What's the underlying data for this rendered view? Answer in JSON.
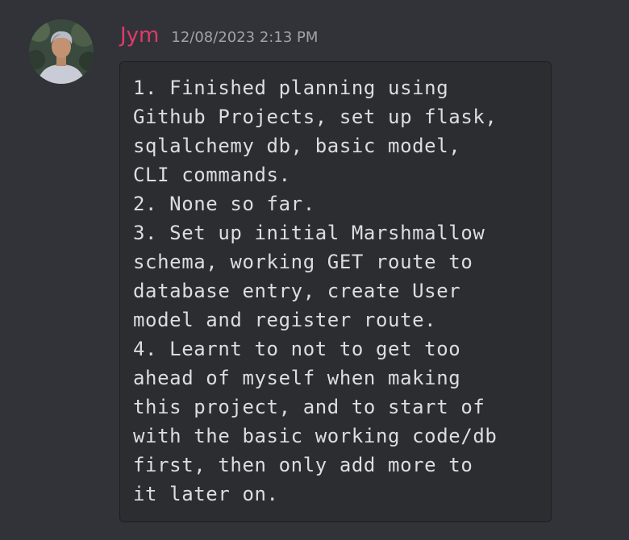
{
  "message": {
    "author": "Jym",
    "timestamp": "12/08/2023 2:13 PM",
    "avatar_icon": "user-avatar",
    "author_color": "#e23a6a",
    "code_lines": [
      "1. Finished planning using",
      "Github Projects, set up flask,",
      "sqlalchemy db, basic model,",
      "CLI commands.",
      "2. None so far.",
      "3. Set up initial Marshmallow",
      "schema, working GET route to",
      "database entry, create User",
      "model and register route.",
      "4. Learnt to not to get too",
      "ahead of myself when making",
      "this project, and to start of",
      "with the basic working code/db",
      "first, then only add more to",
      "it later on."
    ]
  }
}
